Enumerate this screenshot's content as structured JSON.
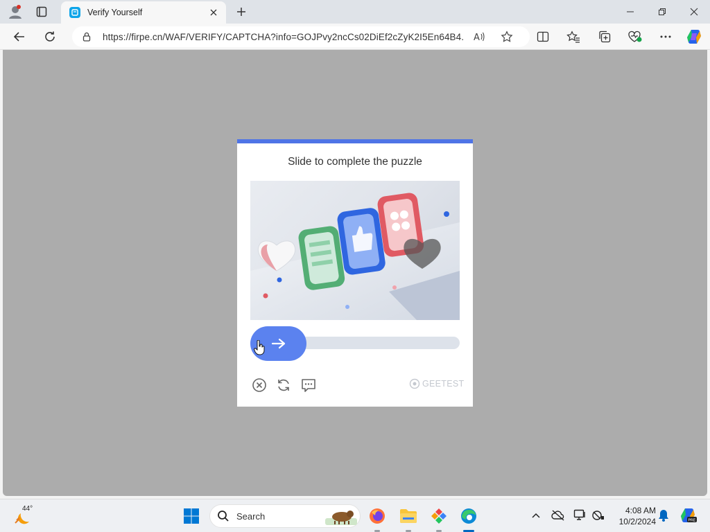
{
  "browser": {
    "tab_title": "Verify Yourself",
    "url": "https://firpe.cn/WAF/VERIFY/CAPTCHA?info=GOJPvy2ncCs02DiEf2cZyK2I5En64B4..."
  },
  "captcha": {
    "title": "Slide to complete the puzzle",
    "brand": "GEETEST",
    "accent_color": "#5b82ef",
    "topbar_color": "#4f74e6",
    "slider_progress": 0
  },
  "taskbar": {
    "weather_temp": "44°",
    "search_label": "Search",
    "time": "4:08 AM",
    "date": "10/2/2024"
  },
  "icons": {
    "tabbar": [
      "profile-icon",
      "tab-actions-icon",
      "new-tab-icon"
    ],
    "toolbar": [
      "back-icon",
      "refresh-icon",
      "lock-icon",
      "read-aloud-icon",
      "favorite-star-icon",
      "split-screen-icon",
      "favorites-icon",
      "collections-icon",
      "browser-essentials-icon",
      "more-icon",
      "copilot-icon"
    ],
    "captcha": [
      "close-circle-icon",
      "refresh-icon",
      "feedback-icon",
      "arrow-right-icon"
    ],
    "taskbar": [
      "weather-icon",
      "start-icon",
      "search-icon",
      "firefox-icon",
      "file-explorer-icon",
      "app-icon",
      "edge-icon",
      "tray-chevron-icon",
      "cloud-offline-icon",
      "display-icon",
      "network-icon",
      "notification-bell-icon",
      "copilot-pre-icon"
    ]
  }
}
